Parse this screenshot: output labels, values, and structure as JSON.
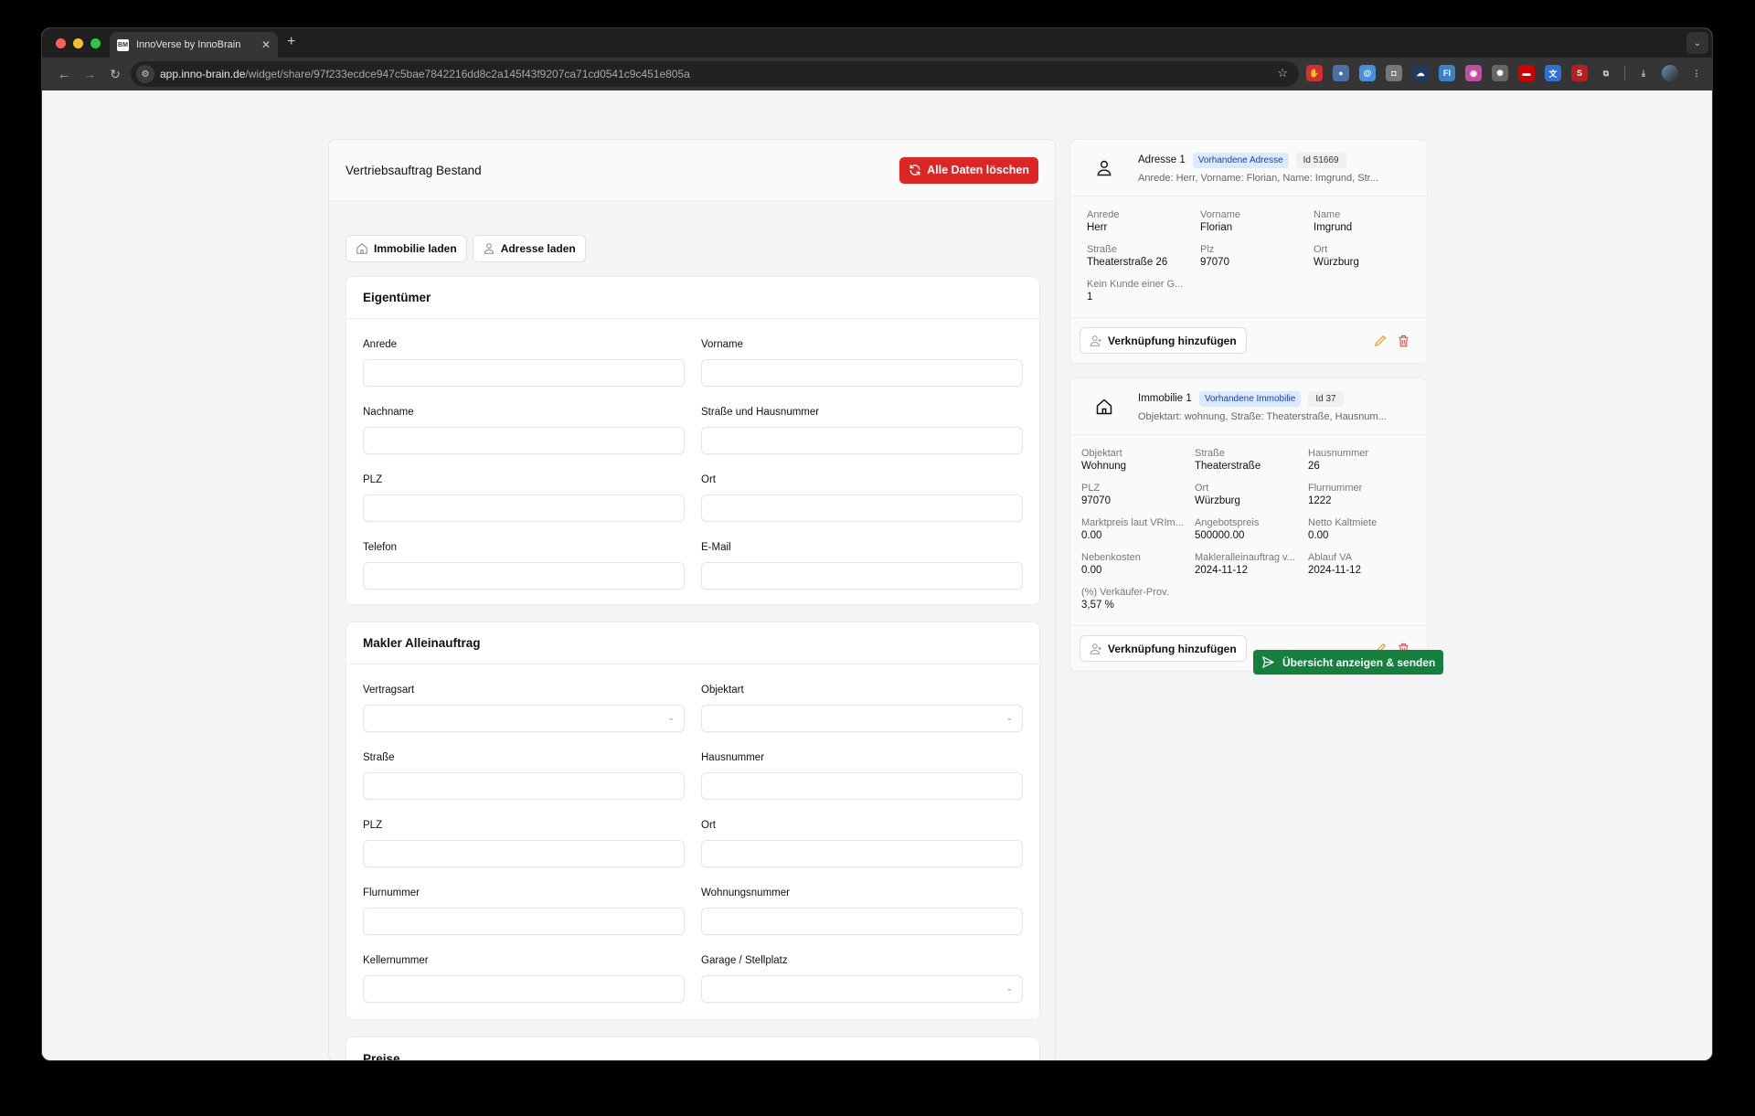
{
  "browser": {
    "tab_title": "InnoVerse by InnoBrain",
    "favicon_text": "BM",
    "url_host": "app.inno-brain.de",
    "url_path": "/widget/share/97f233ecdce947c5bae7842216dd8c2a145f43f9207ca71cd0541c9c451e805a",
    "extensions": [
      {
        "name": "hand-stop-extension",
        "color": "#d32f2f",
        "glyph": "✋"
      },
      {
        "name": "search-person-extension",
        "color": "#4a6fa5",
        "glyph": "●"
      },
      {
        "name": "at-lock-extension",
        "color": "#4a90d9",
        "glyph": "@"
      },
      {
        "name": "camera-extension",
        "color": "#777777",
        "glyph": "◘"
      },
      {
        "name": "cloud-extension",
        "color": "#1e3a5f",
        "glyph": "☁"
      },
      {
        "name": "fi-extension",
        "color": "#3b82c4",
        "glyph": "FI"
      },
      {
        "name": "ghost-extension",
        "color": "#c050a0",
        "glyph": "◉"
      },
      {
        "name": "gear-extension",
        "color": "#666666",
        "glyph": "✺"
      },
      {
        "name": "red-box-extension",
        "color": "#d00000",
        "glyph": "▬"
      },
      {
        "name": "translate-extension",
        "color": "#2f6fd6",
        "glyph": "文"
      },
      {
        "name": "seo-extension",
        "color": "#b22222",
        "glyph": "S"
      },
      {
        "name": "puzzle-extension",
        "color": "#353535",
        "glyph": "⧉"
      }
    ]
  },
  "form": {
    "title": "Vertriebsauftrag Bestand",
    "clear_button": "Alle Daten löschen",
    "load_property_button": "Immobilie laden",
    "load_address_button": "Adresse laden",
    "sections": [
      {
        "title": "Eigentümer",
        "fields": [
          {
            "label": "Anrede",
            "type": "text",
            "value": ""
          },
          {
            "label": "Vorname",
            "type": "text",
            "value": ""
          },
          {
            "label": "Nachname",
            "type": "text",
            "value": ""
          },
          {
            "label": "Straße und Hausnummer",
            "type": "text",
            "value": ""
          },
          {
            "label": "PLZ",
            "type": "text",
            "value": ""
          },
          {
            "label": "Ort",
            "type": "text",
            "value": ""
          },
          {
            "label": "Telefon",
            "type": "text",
            "value": ""
          },
          {
            "label": "E-Mail",
            "type": "text",
            "value": ""
          }
        ]
      },
      {
        "title": "Makler Alleinauftrag",
        "fields": [
          {
            "label": "Vertragsart",
            "type": "select",
            "value": ""
          },
          {
            "label": "Objektart",
            "type": "select",
            "value": ""
          },
          {
            "label": "Straße",
            "type": "text",
            "value": ""
          },
          {
            "label": "Hausnummer",
            "type": "text",
            "value": ""
          },
          {
            "label": "PLZ",
            "type": "text",
            "value": ""
          },
          {
            "label": "Ort",
            "type": "text",
            "value": ""
          },
          {
            "label": "Flurnummer",
            "type": "text",
            "value": ""
          },
          {
            "label": "Wohnungsnummer",
            "type": "text",
            "value": ""
          },
          {
            "label": "Kellernummer",
            "type": "text",
            "value": ""
          },
          {
            "label": "Garage / Stellplatz",
            "type": "select",
            "value": ""
          }
        ]
      },
      {
        "title": "Preise",
        "fields": []
      }
    ]
  },
  "cards": [
    {
      "kind": "address",
      "title": "Adresse 1",
      "badge": "Vorhandene Adresse",
      "id_label": "Id 51669",
      "summary": "Anrede: Herr, Vorname: Florian, Name: Imgrund, Str...",
      "fields": [
        {
          "label": "Anrede",
          "value": "Herr"
        },
        {
          "label": "Vorname",
          "value": "Florian"
        },
        {
          "label": "Name",
          "value": "Imgrund"
        },
        {
          "label": "Straße",
          "value": "Theaterstraße 26"
        },
        {
          "label": "Plz",
          "value": "97070"
        },
        {
          "label": "Ort",
          "value": "Würzburg"
        },
        {
          "label": "Kein Kunde einer G...",
          "value": "1"
        }
      ],
      "link_button": "Verknüpfung hinzufügen"
    },
    {
      "kind": "property",
      "title": "Immobilie 1",
      "badge": "Vorhandene Immobilie",
      "id_label": "Id 37",
      "summary": "Objektart: wohnung, Straße: Theaterstraße, Hausnum...",
      "fields": [
        {
          "label": "Objektart",
          "value": "Wohnung"
        },
        {
          "label": "Straße",
          "value": "Theaterstraße"
        },
        {
          "label": "Hausnummer",
          "value": "26"
        },
        {
          "label": "PLZ",
          "value": "97070"
        },
        {
          "label": "Ort",
          "value": "Würzburg"
        },
        {
          "label": "Flurnummer",
          "value": "1222"
        },
        {
          "label": "Marktpreis laut VRIm...",
          "value": "0.00"
        },
        {
          "label": "Angebotspreis",
          "value": "500000.00"
        },
        {
          "label": "Netto Kaltmiete",
          "value": "0.00"
        },
        {
          "label": "Nebenkosten",
          "value": "0.00"
        },
        {
          "label": "Makleralleinauftrag v...",
          "value": "2024-11-12"
        },
        {
          "label": "Ablauf VA",
          "value": "2024-11-12"
        },
        {
          "label": "(%) Verkäufer-Prov.",
          "value": "3,57 %"
        }
      ],
      "link_button": "Verknüpfung hinzufügen"
    }
  ],
  "submit_button": "Übersicht anzeigen & senden",
  "colors": {
    "danger": "#dc2626",
    "success": "#15803d",
    "badge_bg": "#dbeafe",
    "badge_text": "#1e40af",
    "edit_icon": "#e0a030",
    "delete_icon": "#d9534f"
  }
}
